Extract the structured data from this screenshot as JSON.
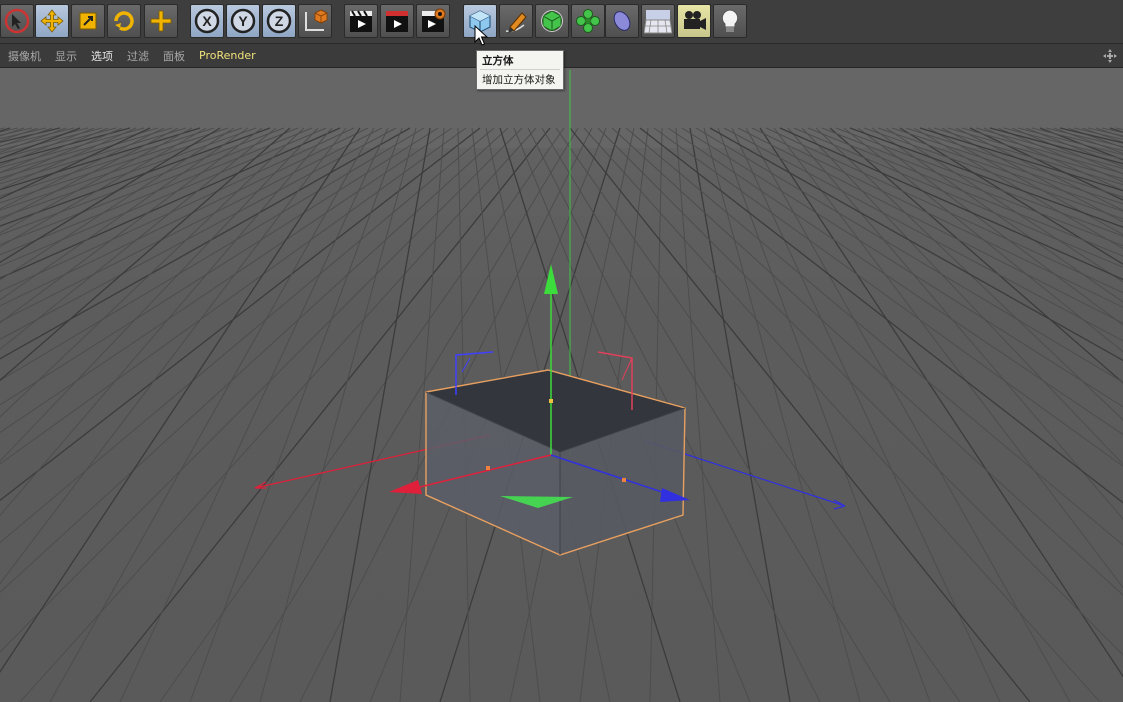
{
  "toolbar": {
    "buttons": [
      {
        "name": "select-tool",
        "icon": "arrow-cursor-icon"
      },
      {
        "name": "move-tool",
        "icon": "move-arrows-icon"
      },
      {
        "name": "scale-tool",
        "icon": "scale-icon"
      },
      {
        "name": "rotate-tool",
        "icon": "rotate-icon"
      },
      {
        "name": "live-select-tool",
        "icon": "crosshair-plus-icon"
      },
      {
        "name": "x-axis-lock",
        "label": "X"
      },
      {
        "name": "y-axis-lock",
        "label": "Y"
      },
      {
        "name": "z-axis-lock",
        "label": "Z"
      },
      {
        "name": "coordinate-system",
        "icon": "axis-cube-icon"
      },
      {
        "name": "render-view",
        "icon": "clapper-play-icon"
      },
      {
        "name": "render-to-picture-viewer",
        "icon": "clapper-red-icon"
      },
      {
        "name": "render-settings",
        "icon": "clapper-gear-icon"
      },
      {
        "name": "cube-object",
        "icon": "cube-icon"
      },
      {
        "name": "pen-spline",
        "icon": "pen-icon"
      },
      {
        "name": "subdivision-surface",
        "icon": "green-cube-icon"
      },
      {
        "name": "cloner",
        "icon": "flower-icon"
      },
      {
        "name": "deformer",
        "icon": "bend-icon"
      },
      {
        "name": "floor-environment",
        "icon": "floor-grid-icon"
      },
      {
        "name": "camera",
        "icon": "camera-icon"
      },
      {
        "name": "light",
        "icon": "bulb-icon"
      }
    ]
  },
  "menubar": {
    "items": [
      "摄像机",
      "显示",
      "选项",
      "过滤",
      "面板",
      "ProRender"
    ]
  },
  "tooltip": {
    "title": "立方体",
    "description": "增加立方体对象"
  },
  "colors": {
    "toolbar_bg": "#3e3e3e",
    "viewport_bg": "#5e5e5e",
    "x_axis": "#e0203a",
    "y_axis": "#3cdc3c",
    "z_axis": "#3030e0",
    "selection_outline": "#e8a060"
  }
}
